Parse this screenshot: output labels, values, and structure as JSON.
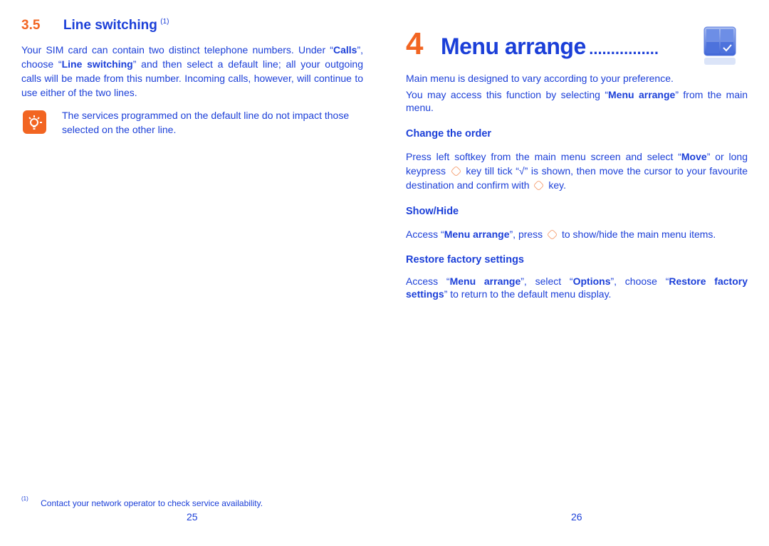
{
  "left_page": {
    "section_number": "3.5",
    "section_title": "Line switching",
    "section_footnote_ref": "(1)",
    "paragraph": [
      {
        "t": "Your SIM card can contain two distinct telephone numbers. Under “"
      },
      {
        "t": "Calls",
        "b": true
      },
      {
        "t": "”, choose “"
      },
      {
        "t": "Line switching",
        "b": true
      },
      {
        "t": "” and then select a default line; all your outgoing calls will be made from this number. Incoming calls, however, will continue to use either of the two lines."
      }
    ],
    "tip_icon": "lightbulb-icon",
    "tip_text": "The services programmed on the default line do not impact those selected on the other line.",
    "footnote_marker": "(1)",
    "footnote_text": "Contact your network operator to check service availability.",
    "page_number": "25"
  },
  "right_page": {
    "chapter_number": "4",
    "chapter_title": "Menu arrange",
    "chapter_leader": "................",
    "chapter_icon": "menu-grid-check-icon",
    "intro1": [
      {
        "t": "Main menu is designed to vary according to your preference."
      }
    ],
    "intro2": [
      {
        "t": "You may access this function by selecting  “"
      },
      {
        "t": "Menu arrange",
        "b": true
      },
      {
        "t": "” from the main menu."
      }
    ],
    "change_order_heading": "Change the order",
    "change_order_text": [
      {
        "t": "Press left softkey from the main menu screen and select “"
      },
      {
        "t": "Move",
        "b": true
      },
      {
        "t": "” or long keypress "
      },
      {
        "icon": "ok-key-icon"
      },
      {
        "t": " key till tick “√” is shown, then move the cursor to your favourite destination and confirm with "
      },
      {
        "icon": "ok-key-icon"
      },
      {
        "t": " key."
      }
    ],
    "show_hide_heading": "Show/Hide",
    "show_hide_text": [
      {
        "t": "Access “"
      },
      {
        "t": "Menu arrange",
        "b": true
      },
      {
        "t": "”, press "
      },
      {
        "icon": "ok-key-icon"
      },
      {
        "t": " to show/hide the main menu items."
      }
    ],
    "restore_heading": "Restore factory settings",
    "restore_text": [
      {
        "t": "Access “"
      },
      {
        "t": "Menu arrange",
        "b": true
      },
      {
        "t": "”, select “"
      },
      {
        "t": "Options",
        "b": true
      },
      {
        "t": "”, choose “"
      },
      {
        "t": "Restore factory settings",
        "b": true
      },
      {
        "t": "” to return to the default menu display."
      }
    ],
    "page_number": "26"
  },
  "colors": {
    "text": "#1b3fd8",
    "accent": "#f26522",
    "key_outline": "#f59a6a"
  }
}
